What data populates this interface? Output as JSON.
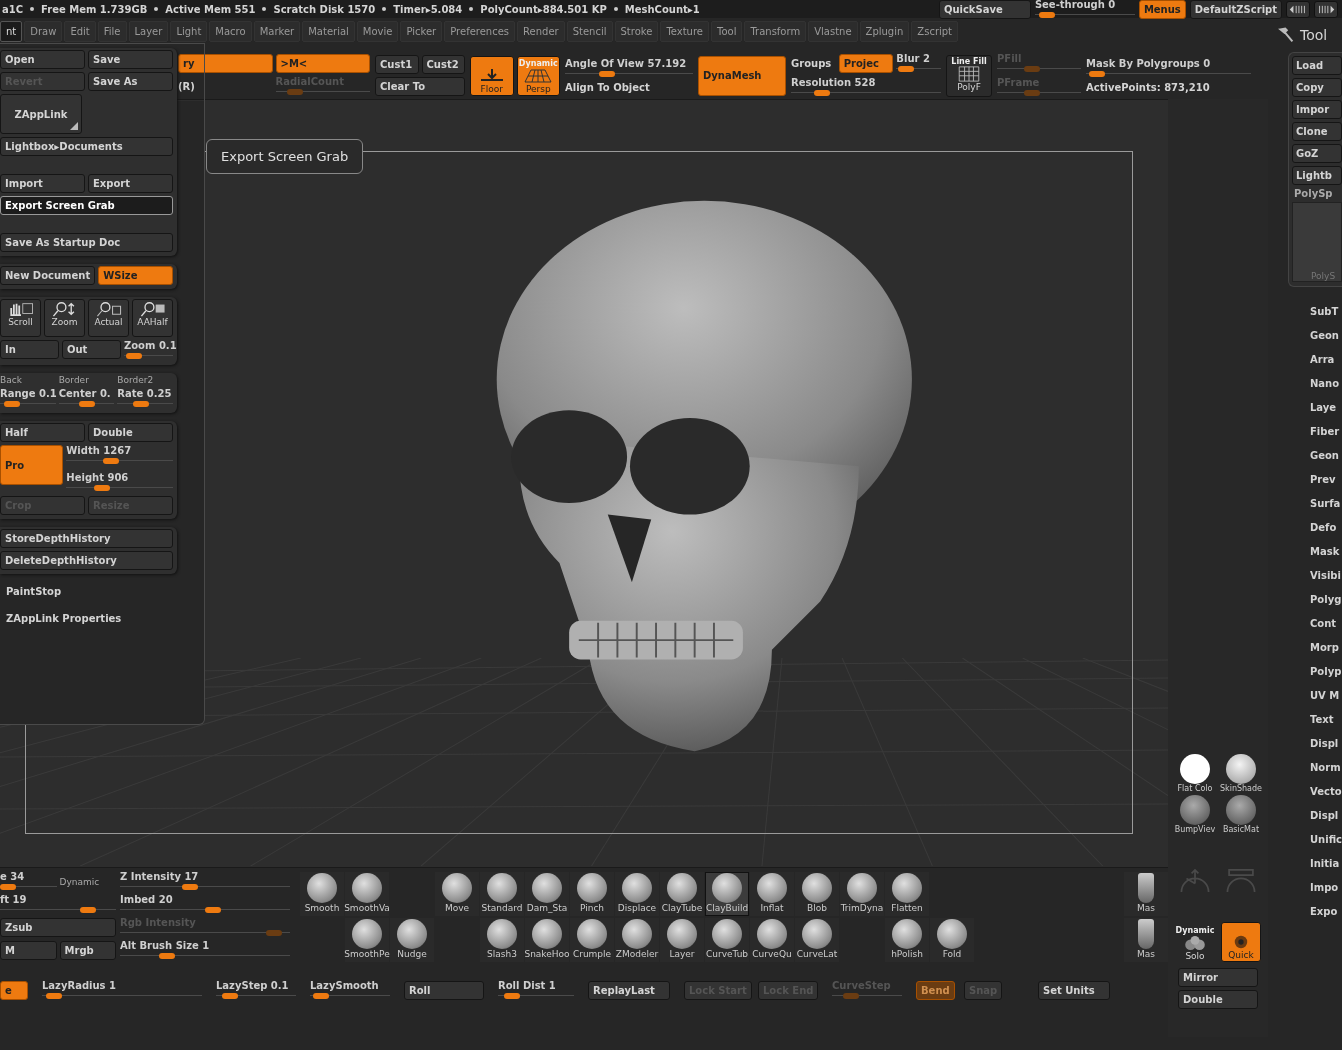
{
  "status_bar": {
    "items": [
      "a1C",
      "Free Mem 1.739GB",
      "Active Mem 551",
      "Scratch Disk 1570",
      "Timer▸5.084",
      "PolyCount▸884.501 KP",
      "MeshCount▸1"
    ],
    "quicksave": "QuickSave",
    "see_through": {
      "kind": "slider",
      "label": "See-through  0",
      "level": 0.05,
      "disabled": false
    },
    "menus": {
      "kind": "button",
      "label": "Menus",
      "on": true,
      "disabled": false,
      "highlighted": false
    },
    "script": "DefaultZScript"
  },
  "menu_bar": [
    {
      "label": "nt",
      "selected": true
    },
    {
      "label": "Draw",
      "selected": false
    },
    {
      "label": "Edit",
      "selected": false
    },
    {
      "label": "File",
      "selected": false
    },
    {
      "label": "Layer",
      "selected": false
    },
    {
      "label": "Light",
      "selected": false
    },
    {
      "label": "Macro",
      "selected": false
    },
    {
      "label": "Marker",
      "selected": false
    },
    {
      "label": "Material",
      "selected": false
    },
    {
      "label": "Movie",
      "selected": false
    },
    {
      "label": "Picker",
      "selected": false
    },
    {
      "label": "Preferences",
      "selected": false
    },
    {
      "label": "Render",
      "selected": false
    },
    {
      "label": "Stencil",
      "selected": false
    },
    {
      "label": "Stroke",
      "selected": false
    },
    {
      "label": "Texture",
      "selected": false
    },
    {
      "label": "Tool",
      "selected": false
    },
    {
      "label": "Transform",
      "selected": false
    },
    {
      "label": "Vlastne",
      "selected": false
    },
    {
      "label": "Zplugin",
      "selected": false
    },
    {
      "label": "Zscript",
      "selected": false
    }
  ],
  "top_shelf": [
    {
      "rows": [
        [
          {
            "kind": "button",
            "label": "ry",
            "on": true,
            "disabled": false,
            "highlighted": false
          },
          {
            "kind": "button",
            "label": ">M<",
            "on": true,
            "disabled": false,
            "highlighted": false
          }
        ],
        [
          {
            "kind": "label",
            "label": "(R)"
          },
          {
            "kind": "slider",
            "label": "RadialCount",
            "level": 0.15,
            "disabled": true
          }
        ]
      ]
    },
    {
      "rows": [
        [
          {
            "kind": "button",
            "label": "Cust1",
            "on": false,
            "disabled": false,
            "highlighted": false
          },
          {
            "kind": "button",
            "label": "Cust2",
            "on": false,
            "disabled": false,
            "highlighted": false
          }
        ],
        [
          {
            "kind": "button",
            "label": "Clear To",
            "on": false,
            "disabled": false,
            "highlighted": false
          }
        ]
      ]
    },
    {
      "rows": [
        [
          {
            "kind": "floor",
            "label": "Floor",
            "on": true,
            "disabled": false
          },
          {
            "kind": "persp",
            "caption": "Dynamic",
            "label": "Persp",
            "on": true,
            "disabled": false
          }
        ]
      ]
    },
    {
      "rows": [
        [
          {
            "kind": "slider",
            "label": "Angle Of View 57.192",
            "level": 0.3,
            "disabled": false
          }
        ],
        [
          {
            "kind": "label",
            "label": "Align To Object"
          }
        ]
      ]
    },
    {
      "rows": [
        [
          {
            "kind": "big",
            "label": "DynaMesh",
            "on": true,
            "disabled": false,
            "highlighted": false
          }
        ]
      ]
    },
    {
      "rows": [
        [
          {
            "kind": "label",
            "label": "Groups"
          },
          {
            "kind": "button",
            "label": "Projec",
            "on": true,
            "disabled": false,
            "highlighted": false
          },
          {
            "kind": "slider",
            "label": "Blur 2",
            "level": 0.05,
            "disabled": false
          }
        ],
        [
          {
            "kind": "slider",
            "label": "Resolution 528",
            "level": 0.17,
            "disabled": false
          }
        ]
      ]
    },
    {
      "rows": [
        [
          {
            "kind": "linefill",
            "caption": "Line Fill",
            "label": "PolyF",
            "on": false,
            "disabled": false
          }
        ]
      ]
    },
    {
      "rows": [
        [
          {
            "kind": "slider",
            "label": "PFill",
            "level": 0.4,
            "disabled": true
          }
        ],
        [
          {
            "kind": "slider",
            "label": "PFrame",
            "level": 0.4,
            "disabled": true
          }
        ]
      ]
    },
    {
      "rows": [
        [
          {
            "kind": "slider",
            "label": "Mask By Polygroups 0",
            "level": 0.02,
            "disabled": false
          }
        ],
        [
          {
            "kind": "label",
            "label": "ActivePoints: 873,210"
          }
        ]
      ]
    }
  ],
  "file_menu": {
    "panels": [
      {
        "sections": [
          [
            [
              {
                "kind": "button",
                "label": "Open",
                "on": false,
                "disabled": false,
                "highlighted": false
              },
              {
                "kind": "button",
                "label": "Save",
                "on": false,
                "disabled": false,
                "highlighted": false
              }
            ],
            [
              {
                "kind": "button",
                "label": "Revert",
                "on": false,
                "disabled": true,
                "highlighted": false
              },
              {
                "kind": "button",
                "label": "Save As",
                "on": false,
                "disabled": false,
                "highlighted": false
              }
            ],
            [
              {
                "kind": "menu",
                "label": "ZAppLink",
                "on": false,
                "disabled": false,
                "highlighted": false
              }
            ],
            [
              {
                "kind": "button",
                "label": "Lightbox▸Documents",
                "on": false,
                "disabled": false,
                "highlighted": false
              }
            ]
          ],
          [
            [
              {
                "kind": "button",
                "label": "Import",
                "on": false,
                "disabled": false,
                "highlighted": false
              },
              {
                "kind": "button",
                "label": "Export",
                "on": false,
                "disabled": false,
                "highlighted": false
              }
            ],
            [
              {
                "kind": "button",
                "label": "Export Screen Grab",
                "on": false,
                "disabled": false,
                "highlighted": true
              }
            ]
          ],
          [
            [
              {
                "kind": "button",
                "label": "Save As Startup Doc",
                "on": false,
                "disabled": false,
                "highlighted": false
              }
            ]
          ]
        ]
      },
      {
        "sections": [
          [
            [
              {
                "kind": "button",
                "label": "New Document",
                "on": false,
                "disabled": false,
                "highlighted": false
              },
              {
                "kind": "button",
                "label": "WSize",
                "on": true,
                "disabled": false,
                "highlighted": false
              }
            ]
          ]
        ]
      },
      {
        "sections": [
          [
            [
              {
                "kind": "hand",
                "label": "Scroll",
                "on": false,
                "disabled": false
              },
              {
                "kind": "zoomer",
                "label": "Zoom",
                "on": false,
                "disabled": false
              },
              {
                "kind": "actual",
                "label": "Actual",
                "on": false,
                "disabled": false
              },
              {
                "kind": "aahalf",
                "label": "AAHalf",
                "on": false,
                "disabled": false
              }
            ],
            [
              {
                "kind": "button",
                "label": "In",
                "on": false,
                "disabled": false,
                "highlighted": false
              },
              {
                "kind": "button",
                "label": "Out",
                "on": false,
                "disabled": false,
                "highlighted": false
              },
              {
                "kind": "slider",
                "label": "Zoom 0.1",
                "level": 0.05,
                "disabled": false
              }
            ]
          ]
        ]
      },
      {
        "sections": [
          [
            [
              {
                "kind": "caption",
                "label": "Back"
              },
              {
                "kind": "caption",
                "label": "Border"
              },
              {
                "kind": "caption",
                "label": "Border2"
              }
            ],
            [
              {
                "kind": "slider",
                "label": "Range 0.1",
                "level": 0.1,
                "disabled": false
              },
              {
                "kind": "slider",
                "label": "Center 0.",
                "level": 0.5,
                "disabled": false
              },
              {
                "kind": "slider",
                "label": "Rate 0.25",
                "level": 0.4,
                "disabled": false
              }
            ]
          ]
        ]
      },
      {
        "sections": [
          [
            [
              {
                "kind": "button",
                "label": "Half",
                "on": false,
                "disabled": false,
                "highlighted": false
              },
              {
                "kind": "button",
                "label": "Double",
                "on": false,
                "disabled": false,
                "highlighted": false
              }
            ],
            [
              {
                "kind": "big",
                "label": "Pro",
                "on": true,
                "disabled": false,
                "highlighted": false
              },
              {
                "kind": "stack",
                "items": [
                  {
                    "kind": "slider",
                    "label": "Width 1267",
                    "level": 0.4,
                    "disabled": false
                  },
                  {
                    "kind": "slider",
                    "label": "Height 906",
                    "level": 0.3,
                    "disabled": false
                  }
                ]
              }
            ],
            [
              {
                "kind": "button",
                "label": "Crop",
                "on": false,
                "disabled": true,
                "highlighted": false
              },
              {
                "kind": "button",
                "label": "Resize",
                "on": false,
                "disabled": true,
                "highlighted": false
              }
            ]
          ]
        ]
      },
      {
        "sections": [
          [
            [
              {
                "kind": "button",
                "label": "StoreDepthHistory",
                "on": false,
                "disabled": false,
                "highlighted": false
              }
            ],
            [
              {
                "kind": "button",
                "label": "DeleteDepthHistory",
                "on": false,
                "disabled": false,
                "highlighted": false
              }
            ]
          ]
        ]
      }
    ],
    "extras": [
      "PaintStop",
      "ZAppLink Properties"
    ]
  },
  "tooltip": "Export Screen Grab",
  "bottom_left": [
    {
      "rows": [
        [
          {
            "kind": "slider",
            "label": "e 34",
            "level": 0.0,
            "disabled": false
          },
          {
            "kind": "caption",
            "label": "Dynamic"
          }
        ],
        [
          {
            "kind": "slider",
            "label": "ft 19",
            "level": 0.8,
            "disabled": false
          }
        ],
        [
          {
            "kind": "button",
            "label": "Zsub",
            "on": false,
            "disabled": false,
            "highlighted": false
          }
        ],
        [
          {
            "kind": "button",
            "label": "M",
            "on": false,
            "disabled": false,
            "highlighted": false
          },
          {
            "kind": "button",
            "label": "Mrgb",
            "on": false,
            "disabled": false,
            "highlighted": false
          }
        ]
      ]
    },
    {
      "rows": [
        [
          {
            "kind": "slider",
            "label": "Z Intensity 17",
            "level": 0.4,
            "disabled": false
          }
        ],
        [
          {
            "kind": "slider",
            "label": "Imbed 20",
            "level": 0.55,
            "disabled": false
          }
        ],
        [
          {
            "kind": "slider",
            "label": "Rgb Intensity",
            "level": 0.95,
            "disabled": true
          }
        ],
        [
          {
            "kind": "slider",
            "label": "Alt Brush Size 1",
            "level": 0.25,
            "disabled": false
          }
        ]
      ]
    }
  ],
  "brushes": [
    {
      "top": {
        "label": "Smooth",
        "selected": false
      }
    },
    {
      "top": {
        "label": "SmoothVa",
        "selected": false
      },
      "bottom": {
        "label": "SmoothPe",
        "selected": false
      }
    },
    {
      "bottom": {
        "label": "Nudge",
        "selected": false
      }
    },
    {
      "top": {
        "label": "Move",
        "selected": false
      }
    },
    {
      "top": {
        "label": "Standard",
        "selected": false
      },
      "bottom": {
        "label": "Slash3",
        "selected": false
      }
    },
    {
      "top": {
        "label": "Dam_Sta",
        "selected": false
      },
      "bottom": {
        "label": "SnakeHoo",
        "selected": false
      }
    },
    {
      "top": {
        "label": "Pinch",
        "selected": false
      },
      "bottom": {
        "label": "Crumple",
        "selected": false
      }
    },
    {
      "top": {
        "label": "Displace",
        "selected": false
      },
      "bottom": {
        "label": "ZModeler",
        "selected": false
      }
    },
    {
      "top": {
        "label": "ClayTube",
        "selected": false
      },
      "bottom": {
        "label": "Layer",
        "selected": false
      }
    },
    {
      "top": {
        "label": "ClayBuild",
        "selected": true
      },
      "bottom": {
        "label": "CurveTub",
        "selected": false
      }
    },
    {
      "top": {
        "label": "Inflat",
        "selected": false
      },
      "bottom": {
        "label": "CurveQu",
        "selected": false
      }
    },
    {
      "top": {
        "label": "Blob",
        "selected": false
      },
      "bottom": {
        "label": "CurveLat",
        "selected": false
      }
    },
    {
      "top": {
        "label": "TrimDyna",
        "selected": false
      }
    },
    {
      "top": {
        "label": "Flatten",
        "selected": false
      },
      "bottom": {
        "label": "hPolish",
        "selected": false
      }
    },
    {
      "bottom": {
        "label": "Fold",
        "selected": false
      }
    }
  ],
  "masks": [
    "Mas",
    "Mas"
  ],
  "bottom_row": [
    {
      "kind": "button",
      "label": "e",
      "on": true,
      "disabled": false,
      "highlighted": false
    },
    {
      "kind": "slider",
      "label": "LazyRadius 1",
      "level": 0.03,
      "disabled": false
    },
    {
      "kind": "slider",
      "label": "LazyStep 0.1",
      "level": 0.1,
      "disabled": false
    },
    {
      "kind": "slider",
      "label": "LazySmooth",
      "level": 0.05,
      "disabled": false
    },
    {
      "kind": "button",
      "label": "Roll",
      "on": false,
      "disabled": false,
      "highlighted": false
    },
    {
      "kind": "slider",
      "label": "Roll  Dist 1",
      "level": 0.1,
      "disabled": false
    },
    {
      "kind": "button",
      "label": "ReplayLast",
      "on": false,
      "disabled": false,
      "highlighted": false
    },
    {
      "kind": "button",
      "label": "Lock Start",
      "on": false,
      "disabled": true,
      "highlighted": false
    },
    {
      "kind": "button",
      "label": "Lock End",
      "on": false,
      "disabled": true,
      "highlighted": false
    },
    {
      "kind": "slider",
      "label": "CurveStep",
      "level": 0.2,
      "disabled": true
    },
    {
      "kind": "button",
      "label": "Bend",
      "on": true,
      "disabled": true,
      "highlighted": false
    },
    {
      "kind": "button",
      "label": "Snap",
      "on": false,
      "disabled": true,
      "highlighted": false
    },
    {
      "kind": "button",
      "label": "Set Units",
      "on": false,
      "disabled": false,
      "highlighted": false
    }
  ],
  "materials": [
    "Flat  Colo",
    "SkinShade",
    "BumpViev",
    "BasicMat"
  ],
  "side_controls": [
    {
      "kind": "solo",
      "caption": "Dynamic",
      "label": "Solo",
      "on": false,
      "disabled": false
    },
    {
      "kind": "quick",
      "label": "Quick",
      "on": true,
      "disabled": false
    }
  ],
  "side_buttons": [
    {
      "kind": "button",
      "label": "Mirror",
      "on": false,
      "disabled": false,
      "highlighted": false
    },
    {
      "kind": "button",
      "label": "Double",
      "on": false,
      "disabled": false,
      "highlighted": false
    }
  ],
  "tool_panel": {
    "title": "Tool",
    "buttons": [
      "Load",
      "Copy",
      "Impor",
      "Clone",
      "GoZ",
      "Lightb"
    ],
    "label": "PolySp",
    "thumb_caption": "PolyS",
    "items": [
      "SubT",
      "Geon",
      "Arra",
      "Nano",
      "Laye",
      "Fiber",
      "Geon",
      "Prev",
      "Surfa",
      "Defo",
      "Mask",
      "Visibi",
      "Polyg",
      "Cont",
      "Morp",
      "Polyp",
      "UV M",
      "Text",
      "Displ",
      "Norm",
      "Vecto",
      "Displ",
      "Unific",
      "Initia",
      "Impo",
      "Expo"
    ]
  }
}
